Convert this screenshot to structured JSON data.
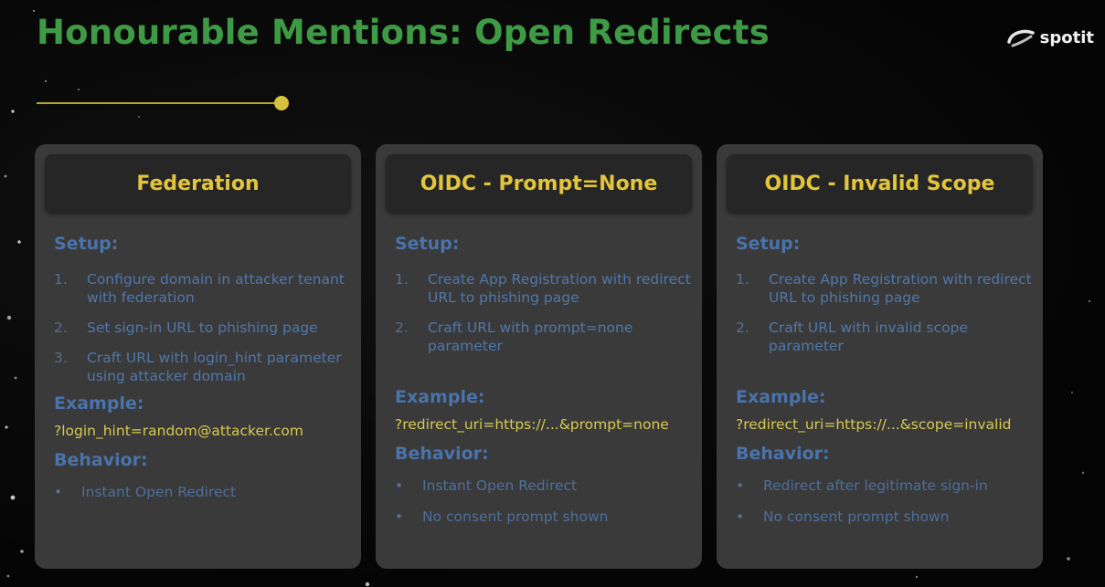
{
  "slide": {
    "title": "Honourable Mentions: Open Redirects",
    "logo_text": "spotit"
  },
  "colors": {
    "title": "#3f9a45",
    "card_header_text": "#e3c53c",
    "section_title": "#4a73ab",
    "example_text": "#d8c94e",
    "accent_line": "#b7a433"
  },
  "cards": [
    {
      "header": "Federation",
      "setup_title": "Setup:",
      "steps": [
        {
          "num": "1.",
          "text": "Configure domain in attacker tenant with federation"
        },
        {
          "num": "2.",
          "text": "Set sign-in URL to phishing page"
        },
        {
          "num": "3.",
          "text": "Craft URL with login_hint parameter using attacker domain"
        }
      ],
      "example_title": "Example:",
      "example": "?login_hint=random@attacker.com",
      "behavior_title": "Behavior:",
      "bullets": [
        "Instant Open Redirect"
      ]
    },
    {
      "header": "OIDC - Prompt=None",
      "setup_title": "Setup:",
      "steps": [
        {
          "num": "1.",
          "text": "Create App Registration with redirect URL to phishing page"
        },
        {
          "num": "2.",
          "text": "Craft URL with prompt=none parameter"
        }
      ],
      "example_title": "Example:",
      "example": "?redirect_uri=https://...&prompt=none",
      "behavior_title": "Behavior:",
      "bullets": [
        "Instant Open Redirect",
        "No consent prompt shown"
      ]
    },
    {
      "header": "OIDC - Invalid Scope",
      "setup_title": "Setup:",
      "steps": [
        {
          "num": "1.",
          "text": "Create App Registration with redirect URL to phishing page"
        },
        {
          "num": "2.",
          "text": "Craft URL with invalid scope parameter"
        }
      ],
      "example_title": "Example:",
      "example": "?redirect_uri=https://...&scope=invalid",
      "behavior_title": "Behavior:",
      "bullets": [
        "Redirect after legitimate sign-in",
        "No consent prompt shown"
      ]
    }
  ]
}
